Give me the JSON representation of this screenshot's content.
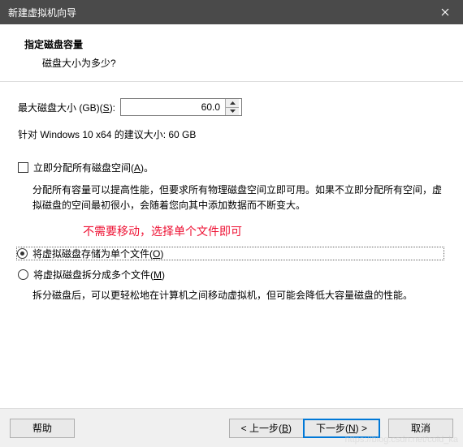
{
  "titlebar": {
    "title": "新建虚拟机向导"
  },
  "header": {
    "title": "指定磁盘容量",
    "subtitle": "磁盘大小为多少?"
  },
  "disk": {
    "label_prefix": "最大磁盘大小 (GB)(",
    "label_accel": "S",
    "label_suffix": "):",
    "value": "60.0",
    "recommend": "针对 Windows 10 x64 的建议大小: 60 GB"
  },
  "allocate": {
    "label_prefix": "立即分配所有磁盘空间(",
    "label_accel": "A",
    "label_suffix": ")。",
    "desc": "分配所有容量可以提高性能，但要求所有物理磁盘空间立即可用。如果不立即分配所有空间，虚拟磁盘的空间最初很小，会随着您向其中添加数据而不断变大。"
  },
  "annotation": "不需要移动，选择单个文件即可",
  "radio_single": {
    "prefix": "将虚拟磁盘存储为单个文件(",
    "accel": "O",
    "suffix": ")"
  },
  "radio_split": {
    "prefix": "将虚拟磁盘拆分成多个文件(",
    "accel": "M",
    "suffix": ")",
    "desc": "拆分磁盘后，可以更轻松地在计算机之间移动虚拟机，但可能会降低大容量磁盘的性能。"
  },
  "buttons": {
    "help": "帮助",
    "back_prefix": "< 上一步(",
    "back_accel": "B",
    "back_suffix": ")",
    "next_prefix": "下一步(",
    "next_accel": "N",
    "next_suffix": ") >",
    "cancel": "取消"
  },
  "watermark": "https://blog.csdn.net/cold_ka"
}
